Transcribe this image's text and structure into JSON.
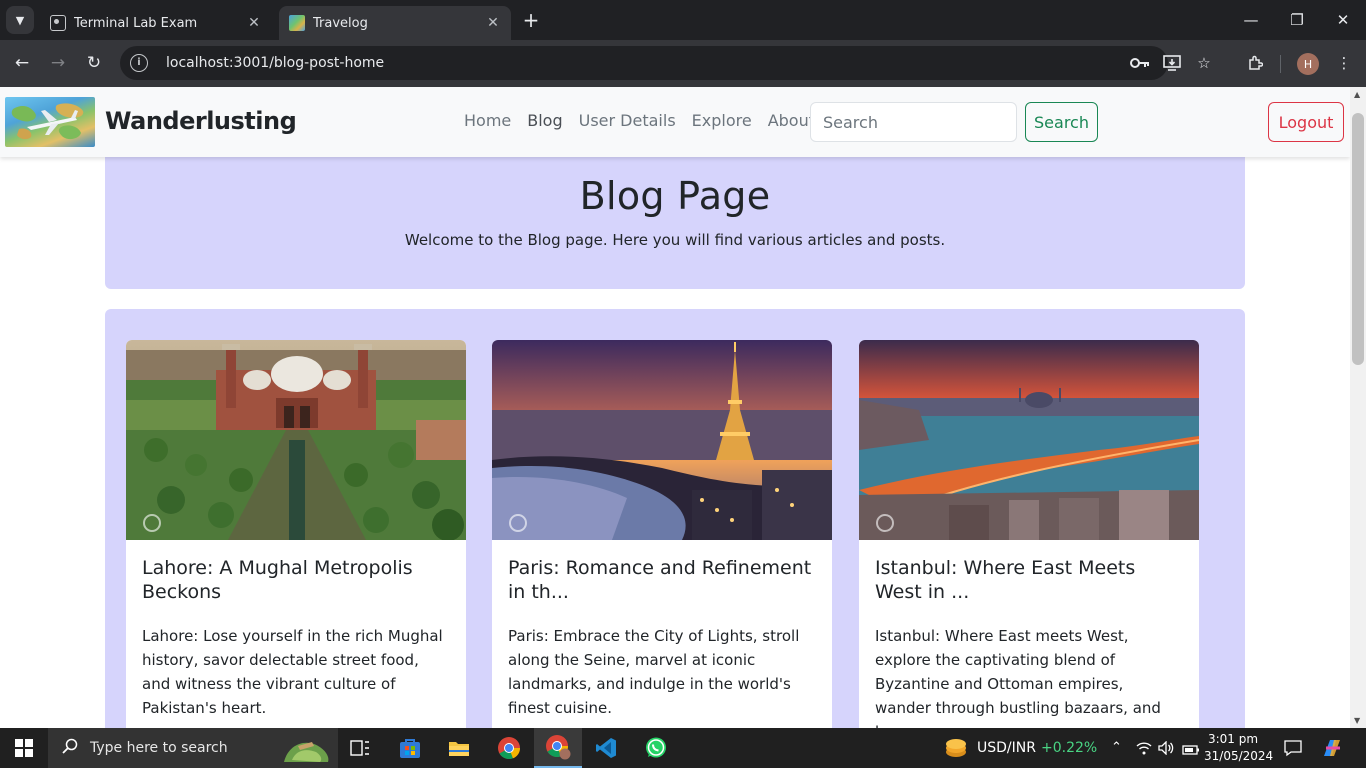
{
  "browser": {
    "tabs": [
      {
        "title": "Terminal Lab Exam",
        "active": false
      },
      {
        "title": "Travelog",
        "active": true
      }
    ],
    "url": "localhost:3001/blog-post-home",
    "profile_initial": "H"
  },
  "site": {
    "brand": "Wanderlusting",
    "nav": [
      "Home",
      "Blog",
      "User Details",
      "Explore",
      "About us"
    ],
    "search_placeholder": "Search",
    "search_button": "Search",
    "logout_button": "Logout"
  },
  "hero": {
    "title": "Blog Page",
    "subtitle": "Welcome to the Blog page. Here you will find various articles and posts."
  },
  "posts": [
    {
      "title": "Lahore: A Mughal Metropolis Beckons",
      "excerpt": "Lahore: Lose yourself in the rich Mughal history, savor delectable street food, and witness the vibrant culture of Pakistan's heart."
    },
    {
      "title": "Paris: Romance and Refinement in th...",
      "excerpt": "Paris: Embrace the City of Lights, stroll along the Seine, marvel at iconic landmarks, and indulge in the world's finest cuisine."
    },
    {
      "title": "Istanbul: Where East Meets West in ...",
      "excerpt": "Istanbul: Where East meets West, explore the captivating blend of Byzantine and Ottoman empires, wander through bustling bazaars, and b..."
    }
  ],
  "taskbar": {
    "search_placeholder": "Type here to search",
    "ticker_label": "USD/INR",
    "ticker_change": "+0.22%",
    "time": "3:01 pm",
    "date": "31/05/2024"
  },
  "colors": {
    "section_bg": "#d6d4fc",
    "success": "#198754",
    "danger": "#dc3545"
  },
  "icons": [
    "tab-search-icon",
    "terminal-favicon",
    "travelog-favicon",
    "close-icon",
    "new-tab-icon",
    "minimize-icon",
    "restore-icon",
    "window-close-icon",
    "back-icon",
    "forward-icon",
    "reload-icon",
    "site-info-icon",
    "key-icon",
    "install-icon",
    "star-icon",
    "extensions-icon",
    "menu-icon",
    "windows-start-icon",
    "search-icon",
    "task-view-icon",
    "store-icon",
    "file-explorer-icon",
    "chrome-icon",
    "vscode-icon",
    "whatsapp-icon",
    "wifi-icon",
    "volume-icon",
    "battery-icon",
    "notifications-icon"
  ]
}
